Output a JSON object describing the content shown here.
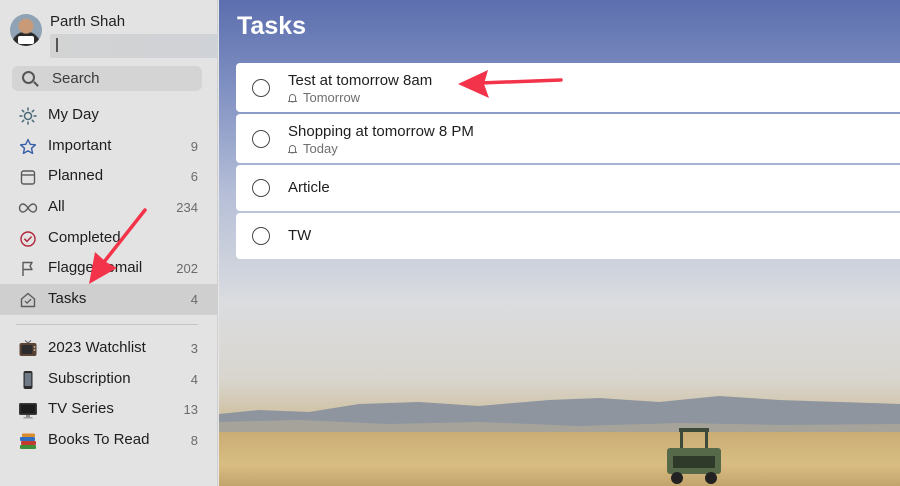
{
  "profile": {
    "name": "Parth Shah"
  },
  "search": {
    "label": "Search"
  },
  "nav": [
    {
      "label": "My Day",
      "count": "",
      "icon": "sun-icon"
    },
    {
      "label": "Important",
      "count": "9",
      "icon": "star-icon"
    },
    {
      "label": "Planned",
      "count": "6",
      "icon": "calendar-icon"
    },
    {
      "label": "All",
      "count": "234",
      "icon": "infinity-icon"
    },
    {
      "label": "Completed",
      "count": "",
      "icon": "check-circle-icon"
    },
    {
      "label": "Flagged email",
      "count": "202",
      "icon": "flag-icon"
    },
    {
      "label": "Tasks",
      "count": "4",
      "icon": "home-icon"
    }
  ],
  "lists": [
    {
      "label": "2023 Watchlist",
      "count": "3",
      "icon": "television-emoji-icon"
    },
    {
      "label": "Subscription",
      "count": "4",
      "icon": "mobile-phone-emoji-icon"
    },
    {
      "label": "TV Series",
      "count": "13",
      "icon": "desktop-computer-emoji-icon"
    },
    {
      "label": "Books To Read",
      "count": "8",
      "icon": "books-emoji-icon"
    }
  ],
  "main": {
    "title": "Tasks",
    "tasks": [
      {
        "title": "Test at tomorrow 8am",
        "reminder": "Tomorrow"
      },
      {
        "title": "Shopping at tomorrow 8 PM",
        "reminder": "Today"
      },
      {
        "title": "Article",
        "reminder": ""
      },
      {
        "title": "TW",
        "reminder": ""
      }
    ]
  },
  "colors": {
    "arrow": "#f2334a",
    "sidebar_bg": "#e3e3e3",
    "active_item": "#cfcfcf"
  }
}
